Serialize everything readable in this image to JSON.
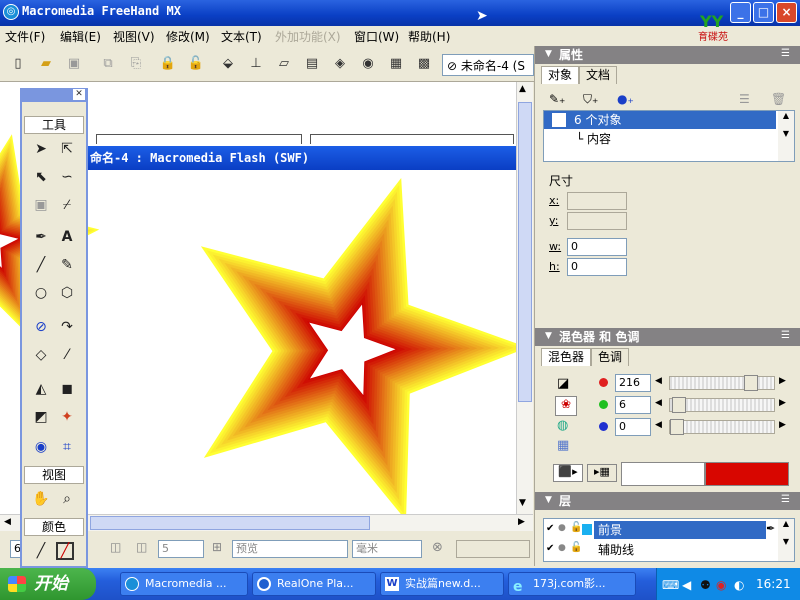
{
  "window": {
    "title": "Macromedia FreeHand MX",
    "logo": "育碟苑",
    "controls": {
      "minimize": "_",
      "maximize": "□",
      "close": "×"
    }
  },
  "menu": [
    "文件(F)",
    "编辑(E)",
    "视图(V)",
    "修改(M)",
    "文本(T)",
    "外加功能(X)",
    "窗口(W)",
    "帮助(H)"
  ],
  "toolbar": {
    "icons": [
      "new-icon",
      "open-icon",
      "save-icon",
      "import-icon",
      "export-icon",
      "lock-icon",
      "unlock-icon",
      "group-icon",
      "align-icon",
      "transform-icon",
      "book-icon",
      "cube-icon",
      "palette-icon",
      "grid-icon",
      "layers-icon"
    ],
    "document": "未命名-4 (S"
  },
  "flash_window": {
    "title": "命名-4 : Macromedia Flash (SWF)"
  },
  "tools": {
    "title": "工具",
    "view_label": "视图",
    "color_label": "颜色",
    "icons": [
      "pointer-icon",
      "subselect-icon",
      "lasso-icon",
      "freeform-icon",
      "trace-icon",
      "eyedropper-icon",
      "pen-icon",
      "text-icon",
      "line-icon",
      "pencil-icon",
      "ellipse-icon",
      "polygon-icon",
      "knife-icon",
      "bezigon-icon",
      "eraser-icon",
      "brush-icon",
      "extrude-icon",
      "shadow-icon",
      "blend-icon",
      "paint-icon",
      "rotate-icon",
      "mirror-icon",
      "hand-icon",
      "zoom-icon",
      "stroke-color-icon",
      "fill-color-icon"
    ]
  },
  "properties": {
    "title": "属性",
    "tabs": [
      "对象",
      "文档"
    ],
    "item": "6 个对象",
    "subitem": "内容",
    "size_label": "尺寸",
    "x_label": "x:",
    "y_label": "y:",
    "w_label": "w:",
    "w_value": "0",
    "h_label": "h:",
    "h_value": "0"
  },
  "mixer": {
    "title": "混色器 和 色调",
    "tabs": [
      "混色器",
      "色调"
    ],
    "r": "216",
    "g": "6",
    "b": "0",
    "colors": {
      "before": "#ffffff",
      "after": "#d80600"
    }
  },
  "layers": {
    "title": "层",
    "items": [
      "前景",
      "辅助线"
    ]
  },
  "status": {
    "page": "6",
    "zoom": "5",
    "mode": "预览",
    "unit": "毫米"
  },
  "taskbar": {
    "start": "开始",
    "tasks": [
      "Macromedia ...",
      "RealOne Pla...",
      "实战篇new.d...",
      "173j.com影..."
    ],
    "clock": "16:21"
  },
  "star": {
    "colors": [
      "#ffff33",
      "#cc0000"
    ],
    "rings": 18
  }
}
